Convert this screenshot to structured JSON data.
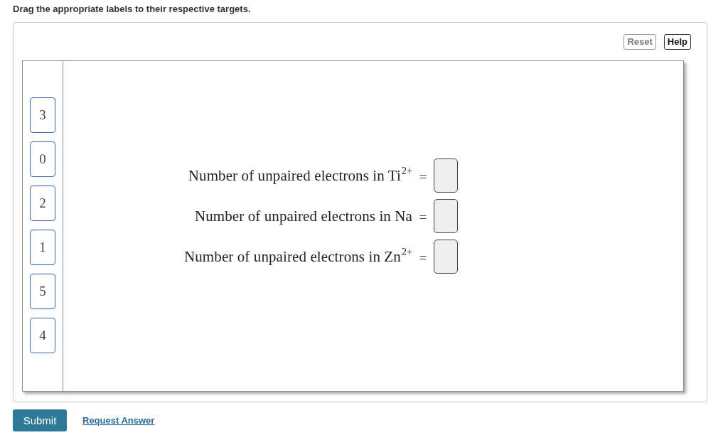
{
  "instruction": "Drag the appropriate labels to their respective targets.",
  "toolbar": {
    "buttons": [
      {
        "label": "Reset",
        "disabled": true
      },
      {
        "label": "Help",
        "disabled": false
      }
    ]
  },
  "labels": [
    "3",
    "0",
    "2",
    "1",
    "5",
    "4"
  ],
  "targets": [
    {
      "text": "Number of unpaired electrons in Ti$^{2+}$",
      "relation": "="
    },
    {
      "text": "Number of unpaired electrons in Na",
      "relation": "="
    },
    {
      "text": "Number of unpaired electrons in Zn$^{2+}$",
      "relation": "="
    }
  ],
  "actions": {
    "submit": "Submit",
    "request_answer": "Request Answer"
  }
}
